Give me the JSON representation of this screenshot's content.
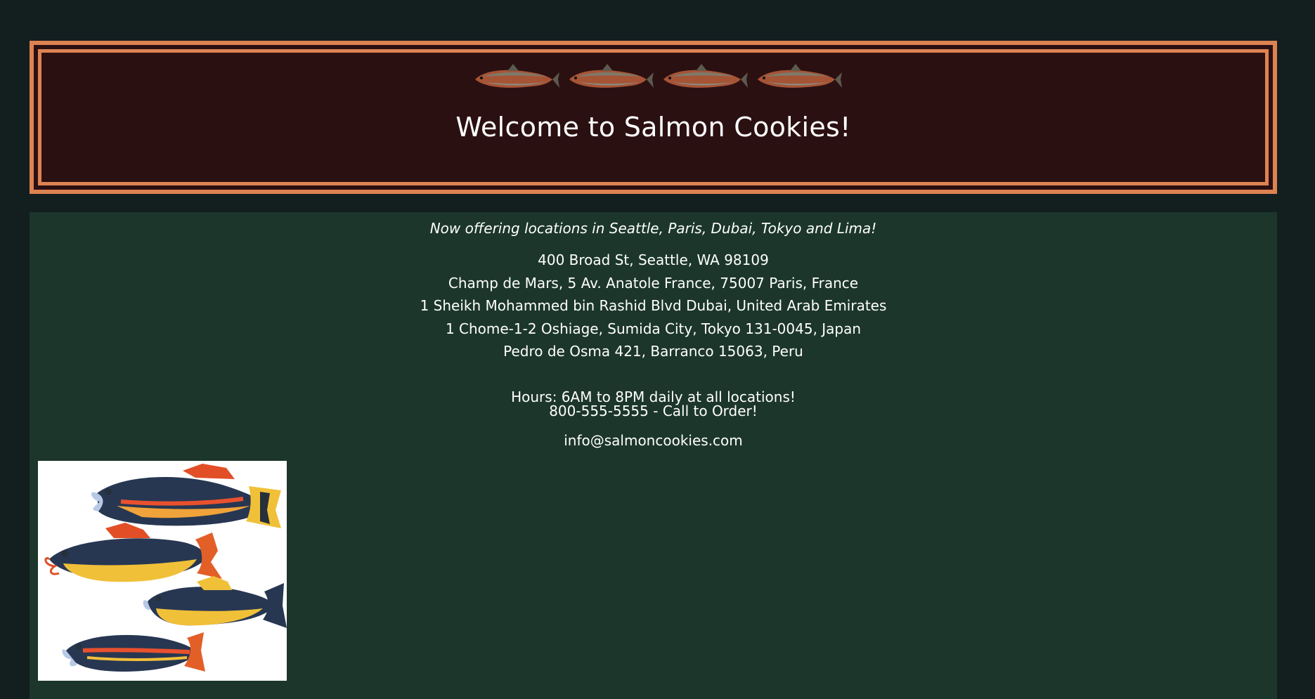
{
  "header": {
    "title": "Welcome to Salmon Cookies!",
    "banner_icons": [
      "salmon-icon",
      "salmon-icon",
      "salmon-icon",
      "salmon-icon"
    ]
  },
  "main": {
    "tagline": "Now offering locations in Seattle, Paris, Dubai, Tokyo and Lima!",
    "addresses": [
      "400 Broad St, Seattle, WA 98109",
      "Champ de Mars, 5 Av. Anatole France, 75007 Paris, France",
      "1 Sheikh Mohammed bin Rashid Blvd Dubai, United Arab Emirates",
      "1 Chome-1-2 Oshiage, Sumida City, Tokyo 131-0045, Japan",
      "Pedro de Osma 421, Barranco 15063, Peru"
    ],
    "hours": "Hours: 6AM to 8PM daily at all locations!",
    "phone": "800-555-5555 - Call to Order!",
    "email": "info@salmoncookies.com",
    "illustration": "salmon-cookies-illustration"
  },
  "colors": {
    "page_background": "#131e1f",
    "header_background": "#2b1012",
    "header_border": "#dd8352",
    "main_background": "#1c362b",
    "text": "#ffffff"
  }
}
